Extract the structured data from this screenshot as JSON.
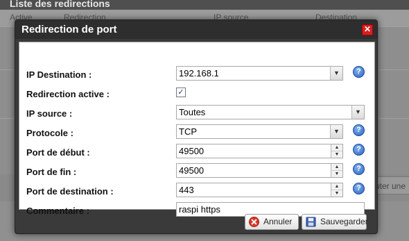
{
  "background": {
    "title": "Liste des redirections",
    "columns": [
      "Active",
      "Redirection",
      "IP source",
      "Destination"
    ],
    "side_button": "uter une"
  },
  "dialog": {
    "title": "Redirection de port",
    "close_label": "✕",
    "fields": {
      "ip_destination": {
        "label": "IP Destination :",
        "value": "192.168.1"
      },
      "redirection_active": {
        "label": "Redirection active :",
        "checked": true,
        "check_glyph": "✓"
      },
      "ip_source": {
        "label": "IP source :",
        "value": "Toutes"
      },
      "protocole": {
        "label": "Protocole :",
        "value": "TCP"
      },
      "port_debut": {
        "label": "Port de début :",
        "value": "49500"
      },
      "port_fin": {
        "label": "Port de fin :",
        "value": "49500"
      },
      "port_destination": {
        "label": "Port de destination :",
        "value": "443"
      },
      "commentaire": {
        "label": "Commentaire :",
        "value": "raspi https"
      }
    },
    "help_glyph": "?",
    "buttons": {
      "cancel": "Annuler",
      "save": "Sauvegarder"
    }
  },
  "colors": {
    "close": "#d52020",
    "help": "#2d66c4",
    "titlebar": "#2e2e2e"
  }
}
